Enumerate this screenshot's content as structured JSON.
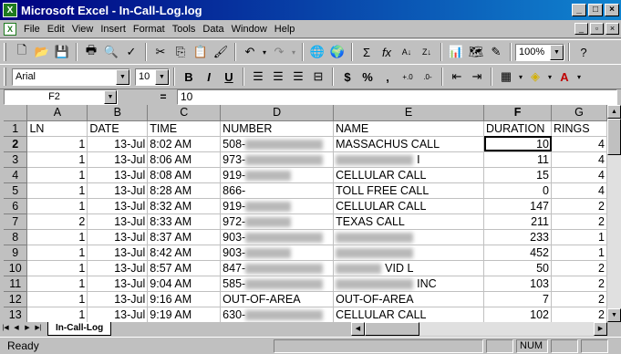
{
  "window": {
    "title": "Microsoft Excel - In-Call-Log.log",
    "app_icon": "X"
  },
  "menu": [
    "File",
    "Edit",
    "View",
    "Insert",
    "Format",
    "Tools",
    "Data",
    "Window",
    "Help"
  ],
  "toolbar1": {
    "zoom": "100%"
  },
  "toolbar2": {
    "font": "Arial",
    "size": "10",
    "bold": "B",
    "italic": "I",
    "underline": "U",
    "currency": "$",
    "percent": "%",
    "comma": ","
  },
  "formula": {
    "namebox": "F2",
    "equals": "=",
    "value": "10"
  },
  "columns": [
    "A",
    "B",
    "C",
    "D",
    "E",
    "F",
    "G"
  ],
  "rows": [
    {
      "n": "1",
      "a": "LN",
      "b": "DATE",
      "c": "TIME",
      "d": "NUMBER",
      "e": "NAME",
      "f": "DURATION",
      "g": "RINGS"
    },
    {
      "n": "2",
      "a": "1",
      "b": "13-Jul",
      "c": "8:02 AM",
      "d": "508-",
      "e": "MASSACHUS CALL",
      "f": "10",
      "g": "4"
    },
    {
      "n": "3",
      "a": "1",
      "b": "13-Jul",
      "c": "8:06 AM",
      "d": "973-",
      "e": "I",
      "f": "11",
      "g": "4"
    },
    {
      "n": "4",
      "a": "1",
      "b": "13-Jul",
      "c": "8:08 AM",
      "d": "919-",
      "e": "CELLULAR CALL",
      "f": "15",
      "g": "4"
    },
    {
      "n": "5",
      "a": "1",
      "b": "13-Jul",
      "c": "8:28 AM",
      "d": "866-",
      "e": "TOLL FREE CALL",
      "f": "0",
      "g": "4"
    },
    {
      "n": "6",
      "a": "1",
      "b": "13-Jul",
      "c": "8:32 AM",
      "d": "919-",
      "e": "CELLULAR CALL",
      "f": "147",
      "g": "2"
    },
    {
      "n": "7",
      "a": "2",
      "b": "13-Jul",
      "c": "8:33 AM",
      "d": "972-",
      "e": "TEXAS CALL",
      "f": "211",
      "g": "2"
    },
    {
      "n": "8",
      "a": "1",
      "b": "13-Jul",
      "c": "8:37 AM",
      "d": "903-",
      "e": "",
      "f": "233",
      "g": "1"
    },
    {
      "n": "9",
      "a": "1",
      "b": "13-Jul",
      "c": "8:42 AM",
      "d": "903-",
      "e": "",
      "f": "452",
      "g": "1"
    },
    {
      "n": "10",
      "a": "1",
      "b": "13-Jul",
      "c": "8:57 AM",
      "d": "847-",
      "e": "VID L",
      "f": "50",
      "g": "2"
    },
    {
      "n": "11",
      "a": "1",
      "b": "13-Jul",
      "c": "9:04 AM",
      "d": "585-",
      "e": "INC",
      "f": "103",
      "g": "2"
    },
    {
      "n": "12",
      "a": "1",
      "b": "13-Jul",
      "c": "9:16 AM",
      "d": "OUT-OF-AREA",
      "e": "OUT-OF-AREA",
      "f": "7",
      "g": "2"
    },
    {
      "n": "13",
      "a": "1",
      "b": "13-Jul",
      "c": "9:19 AM",
      "d": "630-",
      "e": "CELLULAR CALL",
      "f": "102",
      "g": "2"
    }
  ],
  "sheet_tab": "In-Call-Log",
  "status": {
    "ready": "Ready",
    "num": "NUM"
  }
}
